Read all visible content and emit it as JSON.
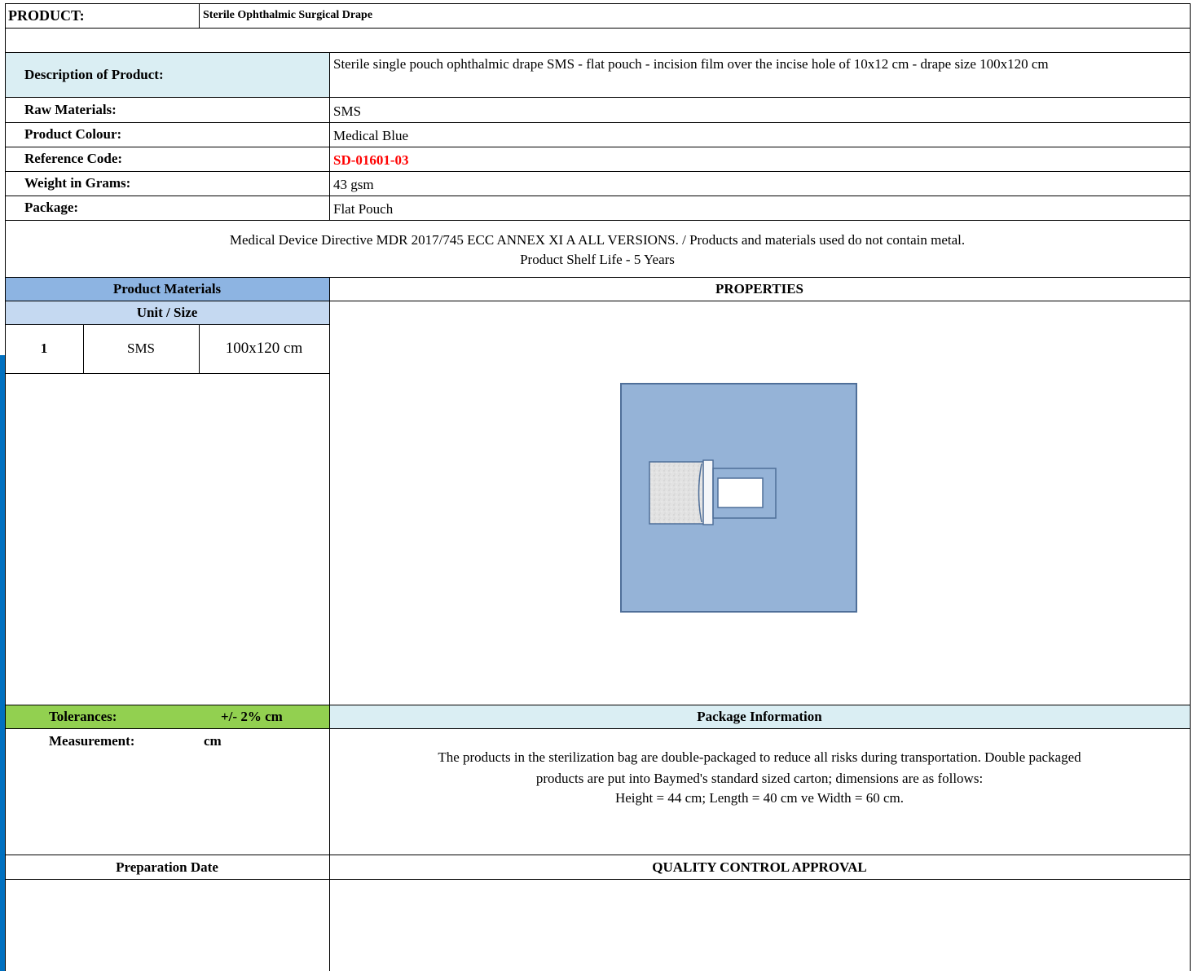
{
  "header": {
    "product_label": "PRODUCT:",
    "product_name": "Sterile Ophthalmic Surgical Drape"
  },
  "specs": {
    "description_label": "Description of Product:",
    "description_value": "Sterile single pouch ophthalmic drape SMS - flat pouch - incision film over the incise hole of 10x12 cm - drape size 100x120 cm",
    "raw_label": "Raw  Materials:",
    "raw_value": "SMS",
    "colour_label": "Product Colour:",
    "colour_value": "Medical Blue",
    "ref_label": "Reference Code:",
    "ref_value": "SD-01601-03",
    "weight_label": "Weight in Grams:",
    "weight_value": "43 gsm",
    "package_label": "Package:",
    "package_value": "Flat Pouch"
  },
  "directive": {
    "line1": "Medical Device Directive MDR 2017/745 ECC ANNEX XI A ALL VERSIONS. / Products and materials used do not contain metal.",
    "line2": "Product Shelf Life - 5 Years"
  },
  "materials": {
    "title": "Product Materials",
    "subtitle": "Unit / Size",
    "rows": [
      {
        "num": "1",
        "material": "SMS",
        "size": "100x120 cm"
      }
    ]
  },
  "properties": {
    "title": "PROPERTIES"
  },
  "tolerances": {
    "label": "Tolerances:",
    "value": "+/- 2% cm",
    "measurement_label": "Measurement:",
    "measurement_value": "cm"
  },
  "package_info": {
    "title": "Package Information",
    "line1": "The products in the sterilization bag are double-packaged to reduce all risks during transportation. Double packaged",
    "line2": "products are put into Baymed's standard sized carton; dimensions are as follows:",
    "line3": "Height = 44 cm; Length = 40 cm ve Width = 60 cm."
  },
  "footer": {
    "prep_date_label": "Preparation Date",
    "qc_label": "QUALITY CONTROL APPROVAL"
  },
  "colors": {
    "desc_bg": "#daeef3",
    "materials_header_bg": "#8db4e2",
    "unit_header_bg": "#c5d9f1",
    "tolerance_bg": "#92d050",
    "package_header_bg": "#daeef3",
    "ref_code": "#ff0000",
    "left_edge": "#0070c0",
    "drape": "#95b3d7"
  }
}
